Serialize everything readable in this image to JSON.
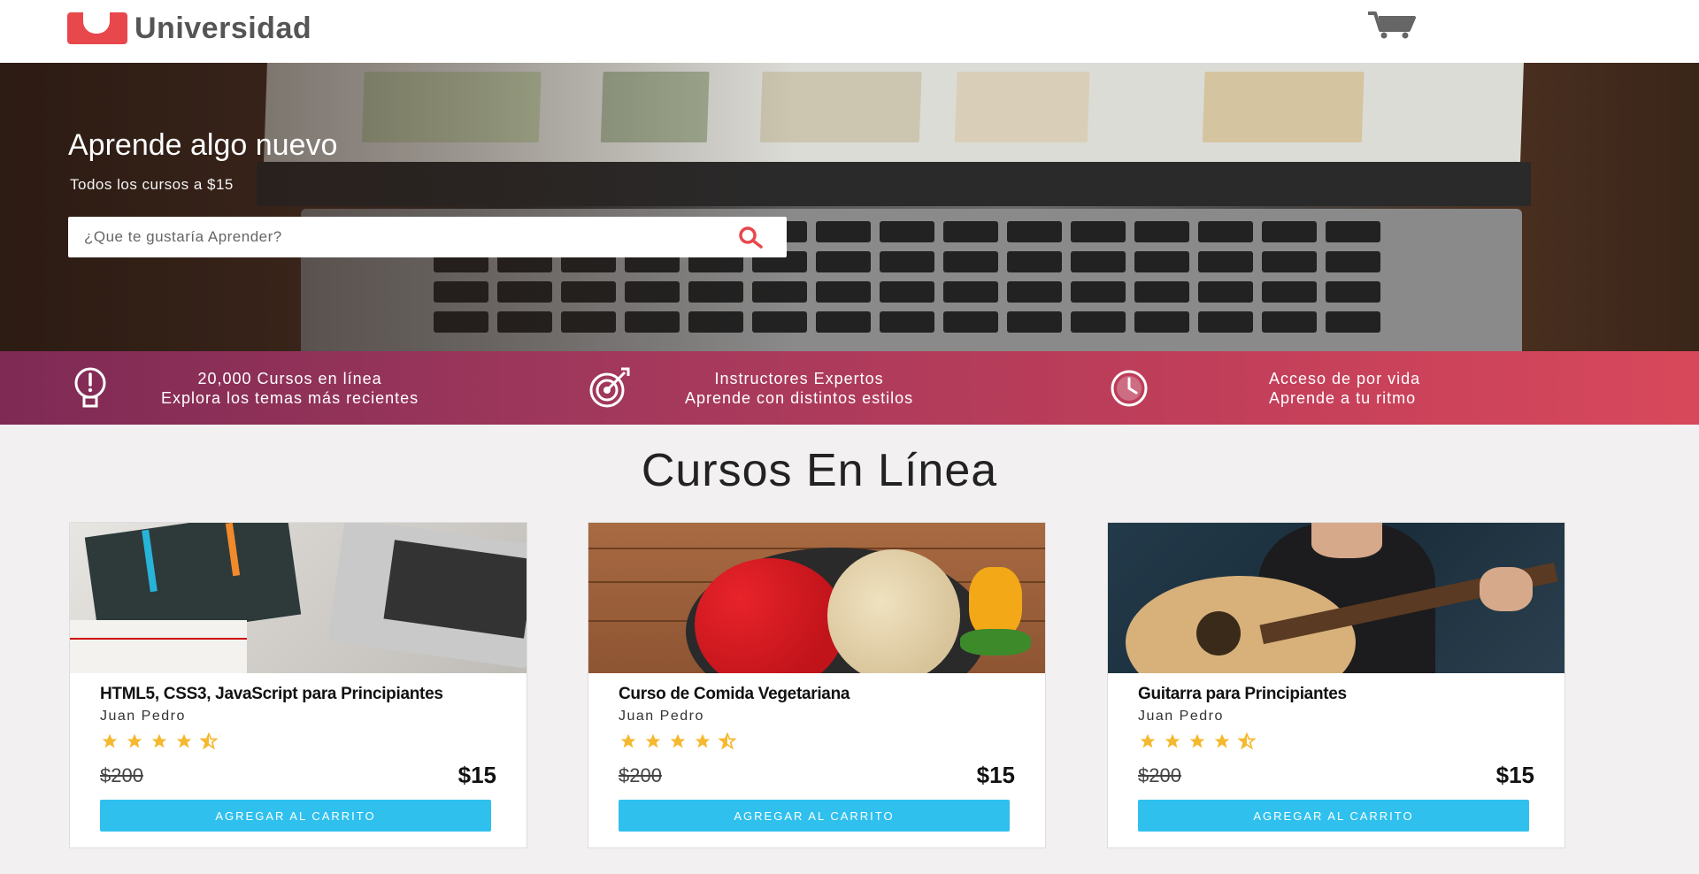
{
  "header": {
    "brand": "Universidad",
    "cart_icon": "shopping-cart-icon"
  },
  "hero": {
    "title": "Aprende algo nuevo",
    "subtitle": "Todos los cursos a $15",
    "search_placeholder": "¿Que te gustaría Aprender?",
    "search_icon": "search-icon"
  },
  "features": [
    {
      "icon": "lightbulb-icon",
      "line1": "20,000 Cursos en línea",
      "line2": "Explora los temas más recientes"
    },
    {
      "icon": "target-icon",
      "line1": "Instructores Expertos",
      "line2": "Aprende con distintos estilos"
    },
    {
      "icon": "clock-icon",
      "line1": "Acceso de por vida",
      "line2": "Aprende a tu ritmo"
    }
  ],
  "section": {
    "title": "Cursos En Línea"
  },
  "courses": [
    {
      "title": "HTML5, CSS3, JavaScript para Principiantes",
      "author": "Juan Pedro",
      "rating": 4.5,
      "old_price": "$200",
      "price": "$15",
      "button": "AGREGAR AL CARRITO"
    },
    {
      "title": "Curso de Comida Vegetariana",
      "author": "Juan Pedro",
      "rating": 4.5,
      "old_price": "$200",
      "price": "$15",
      "button": "AGREGAR AL CARRITO"
    },
    {
      "title": "Guitarra para Principiantes",
      "author": "Juan Pedro",
      "rating": 4.5,
      "old_price": "$200",
      "price": "$15",
      "button": "AGREGAR AL CARRITO"
    }
  ],
  "colors": {
    "brand_red": "#e8474c",
    "button_blue": "#2fc0ee",
    "star_yellow": "#f5b82e",
    "feature_bar_start": "#7e2a55",
    "feature_bar_end": "#d8485b"
  }
}
